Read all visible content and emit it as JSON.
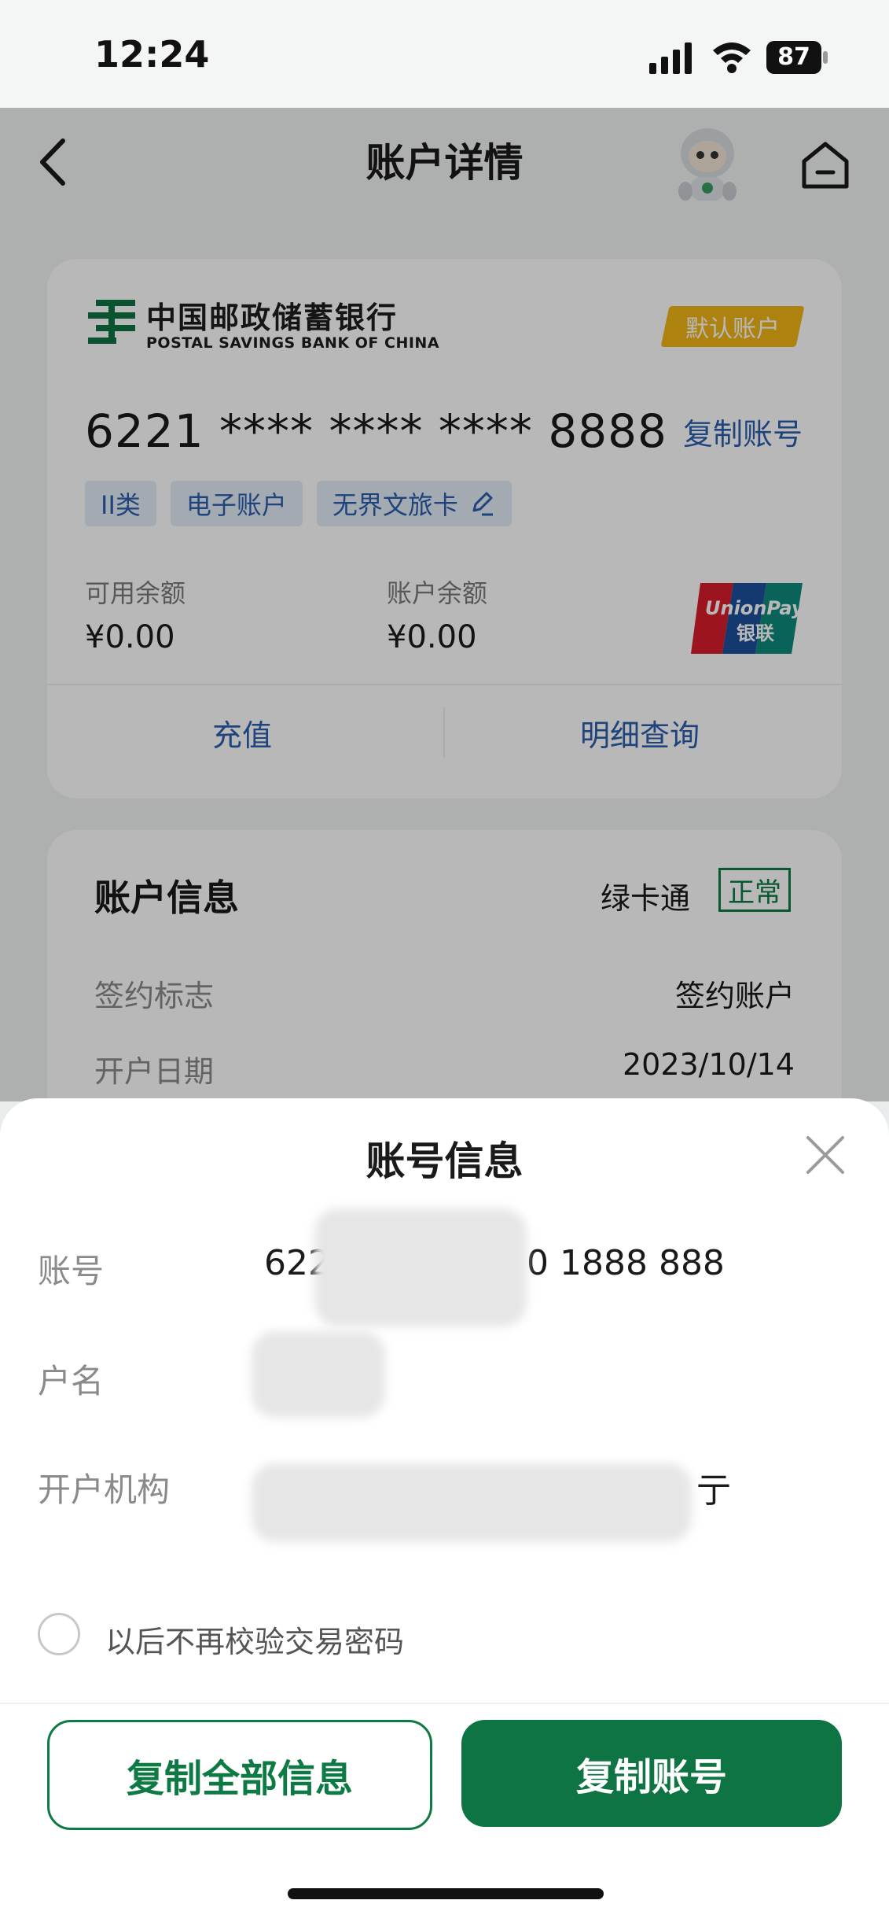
{
  "status_bar": {
    "time": "12:24",
    "battery": "87"
  },
  "nav": {
    "title": "账户详情"
  },
  "card": {
    "bank_name_cn": "中国邮政储蓄银行",
    "bank_name_en": "POSTAL SAVINGS BANK OF CHINA",
    "default_badge": "默认账户",
    "card_number": "6221 **** **** **** 8888",
    "copy_label": "复制账号",
    "tags": [
      "II类",
      "电子账户",
      "无界文旅卡"
    ],
    "available_label": "可用余额",
    "available_value": "¥0.00",
    "balance_label": "账户余额",
    "balance_value": "¥0.00",
    "unionpay_text": "UnionPay",
    "unionpay_cn": "银联",
    "action_recharge": "充值",
    "action_details": "明细查询"
  },
  "account_info": {
    "title": "账户信息",
    "card_type": "绿卡通",
    "status": "正常",
    "rows": [
      {
        "label": "签约标志",
        "value": "签约账户"
      },
      {
        "label": "开户日期",
        "value": "2023/10/14"
      }
    ]
  },
  "sheet": {
    "title": "账号信息",
    "account_label": "账号",
    "account_value_prefix": "622",
    "account_value_suffix": "0 1888 888",
    "name_label": "户名",
    "branch_label": "开户机构",
    "branch_suffix": "亍",
    "checkbox_label": "以后不再校验交易密码",
    "copy_all_button": "复制全部信息",
    "copy_account_button": "复制账号"
  },
  "colors": {
    "brand_green": "#0e7443",
    "link_blue": "#2b5fad",
    "badge_gold": "#f2b416"
  }
}
